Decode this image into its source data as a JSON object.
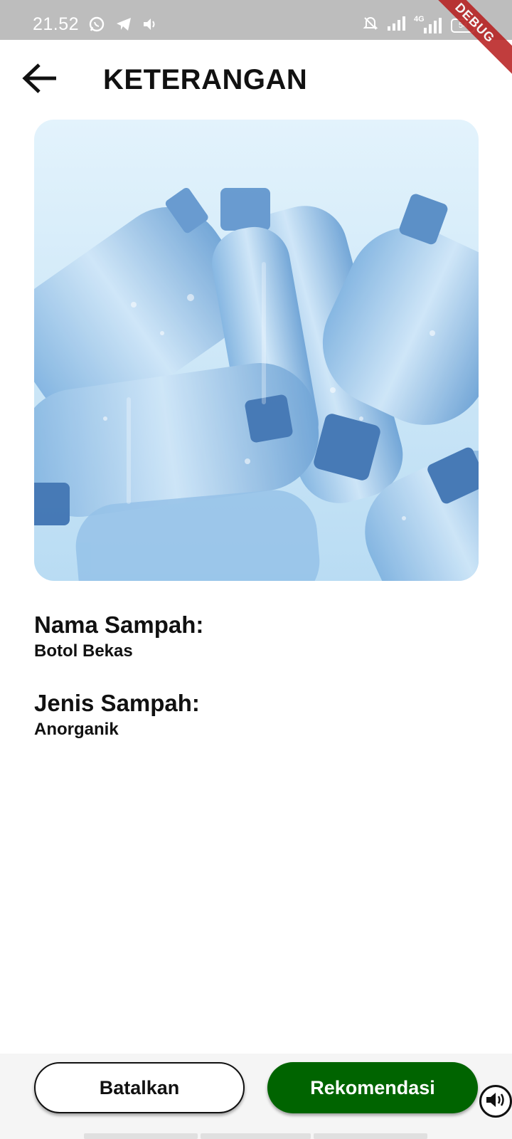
{
  "status_bar": {
    "time": "21.52",
    "left_icons": [
      "whatsapp-icon",
      "telegram-icon",
      "volume-icon"
    ],
    "right_icons": [
      "mute-bell-icon",
      "signal-icon",
      "4g-signal-icon"
    ],
    "network_label": "4G",
    "battery": "54"
  },
  "debug_banner": "DEBUG",
  "app_bar": {
    "title": "KETERANGAN",
    "back_icon": "arrow-left-icon"
  },
  "image": {
    "subject": "plastic bottles",
    "colors": {
      "background": "#cfe8f8",
      "bottle": "#9ec8ec",
      "bottle_dark": "#4f86c2",
      "cap": "#3a6fb0"
    }
  },
  "details": [
    {
      "label": "Nama Sampah:",
      "value": "Botol Bekas"
    },
    {
      "label": "Jenis Sampah:",
      "value": "Anorganik"
    }
  ],
  "actions": {
    "cancel_label": "Batalkan",
    "recommend_label": "Rekomendasi"
  },
  "colors": {
    "primary": "#006400",
    "status_bar": "#bdbdbd",
    "debug": "#b71c1c"
  }
}
